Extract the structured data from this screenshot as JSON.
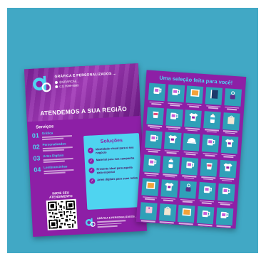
{
  "colors": {
    "background": "#41a8c5",
    "flyer_purple": "#8d1fa6",
    "accent_cyan": "#4fd4f0"
  },
  "front": {
    "brand": "GRÁFICA E PERSONALIZADOS ...",
    "contact": [
      "@GRAFICAE...",
      "(11) 9999-9999"
    ],
    "headline": "ATENDEMOS A SUA REGIÃO",
    "services_title": "Serviços",
    "services": [
      {
        "num": "01",
        "name": "Gráfica"
      },
      {
        "num": "02",
        "name": "Personalizados"
      },
      {
        "num": "03",
        "name": "Artes Digitais"
      },
      {
        "num": "04",
        "name": "Lembrancinhas"
      }
    ],
    "solutions_title": "Soluções",
    "solutions": [
      "Identidade visual para o seu negócio",
      "Material para sua campanha",
      "Presente ideal para aquela data especial",
      "Artes digitais para suas redes"
    ],
    "qr_title": "INICIE SEU ATENDIMENTO",
    "footer_brand": "GRÁFICA E PERSONALIZADOS ..."
  },
  "back": {
    "title": "Uma seleção feita para você!",
    "products": [
      "mug-icon",
      "mug-icon",
      "frame-icon",
      "notebook-icon",
      "keychain-icon",
      "cup-icon",
      "mug-icon",
      "shirt-icon",
      "bottle-icon",
      "bag-icon",
      "mug-icon",
      "shirt-icon",
      "cap-icon",
      "mug-icon",
      "shirt-icon",
      "mug-icon",
      "bottle-icon",
      "mug-icon",
      "cup-icon",
      "shirt-icon",
      "frame-icon",
      "shirt-icon",
      "keychain-icon",
      "mug-icon",
      "mug-icon",
      "tag-icon",
      "bag-icon",
      "frame-icon",
      "mug-icon",
      "mug-icon"
    ]
  }
}
